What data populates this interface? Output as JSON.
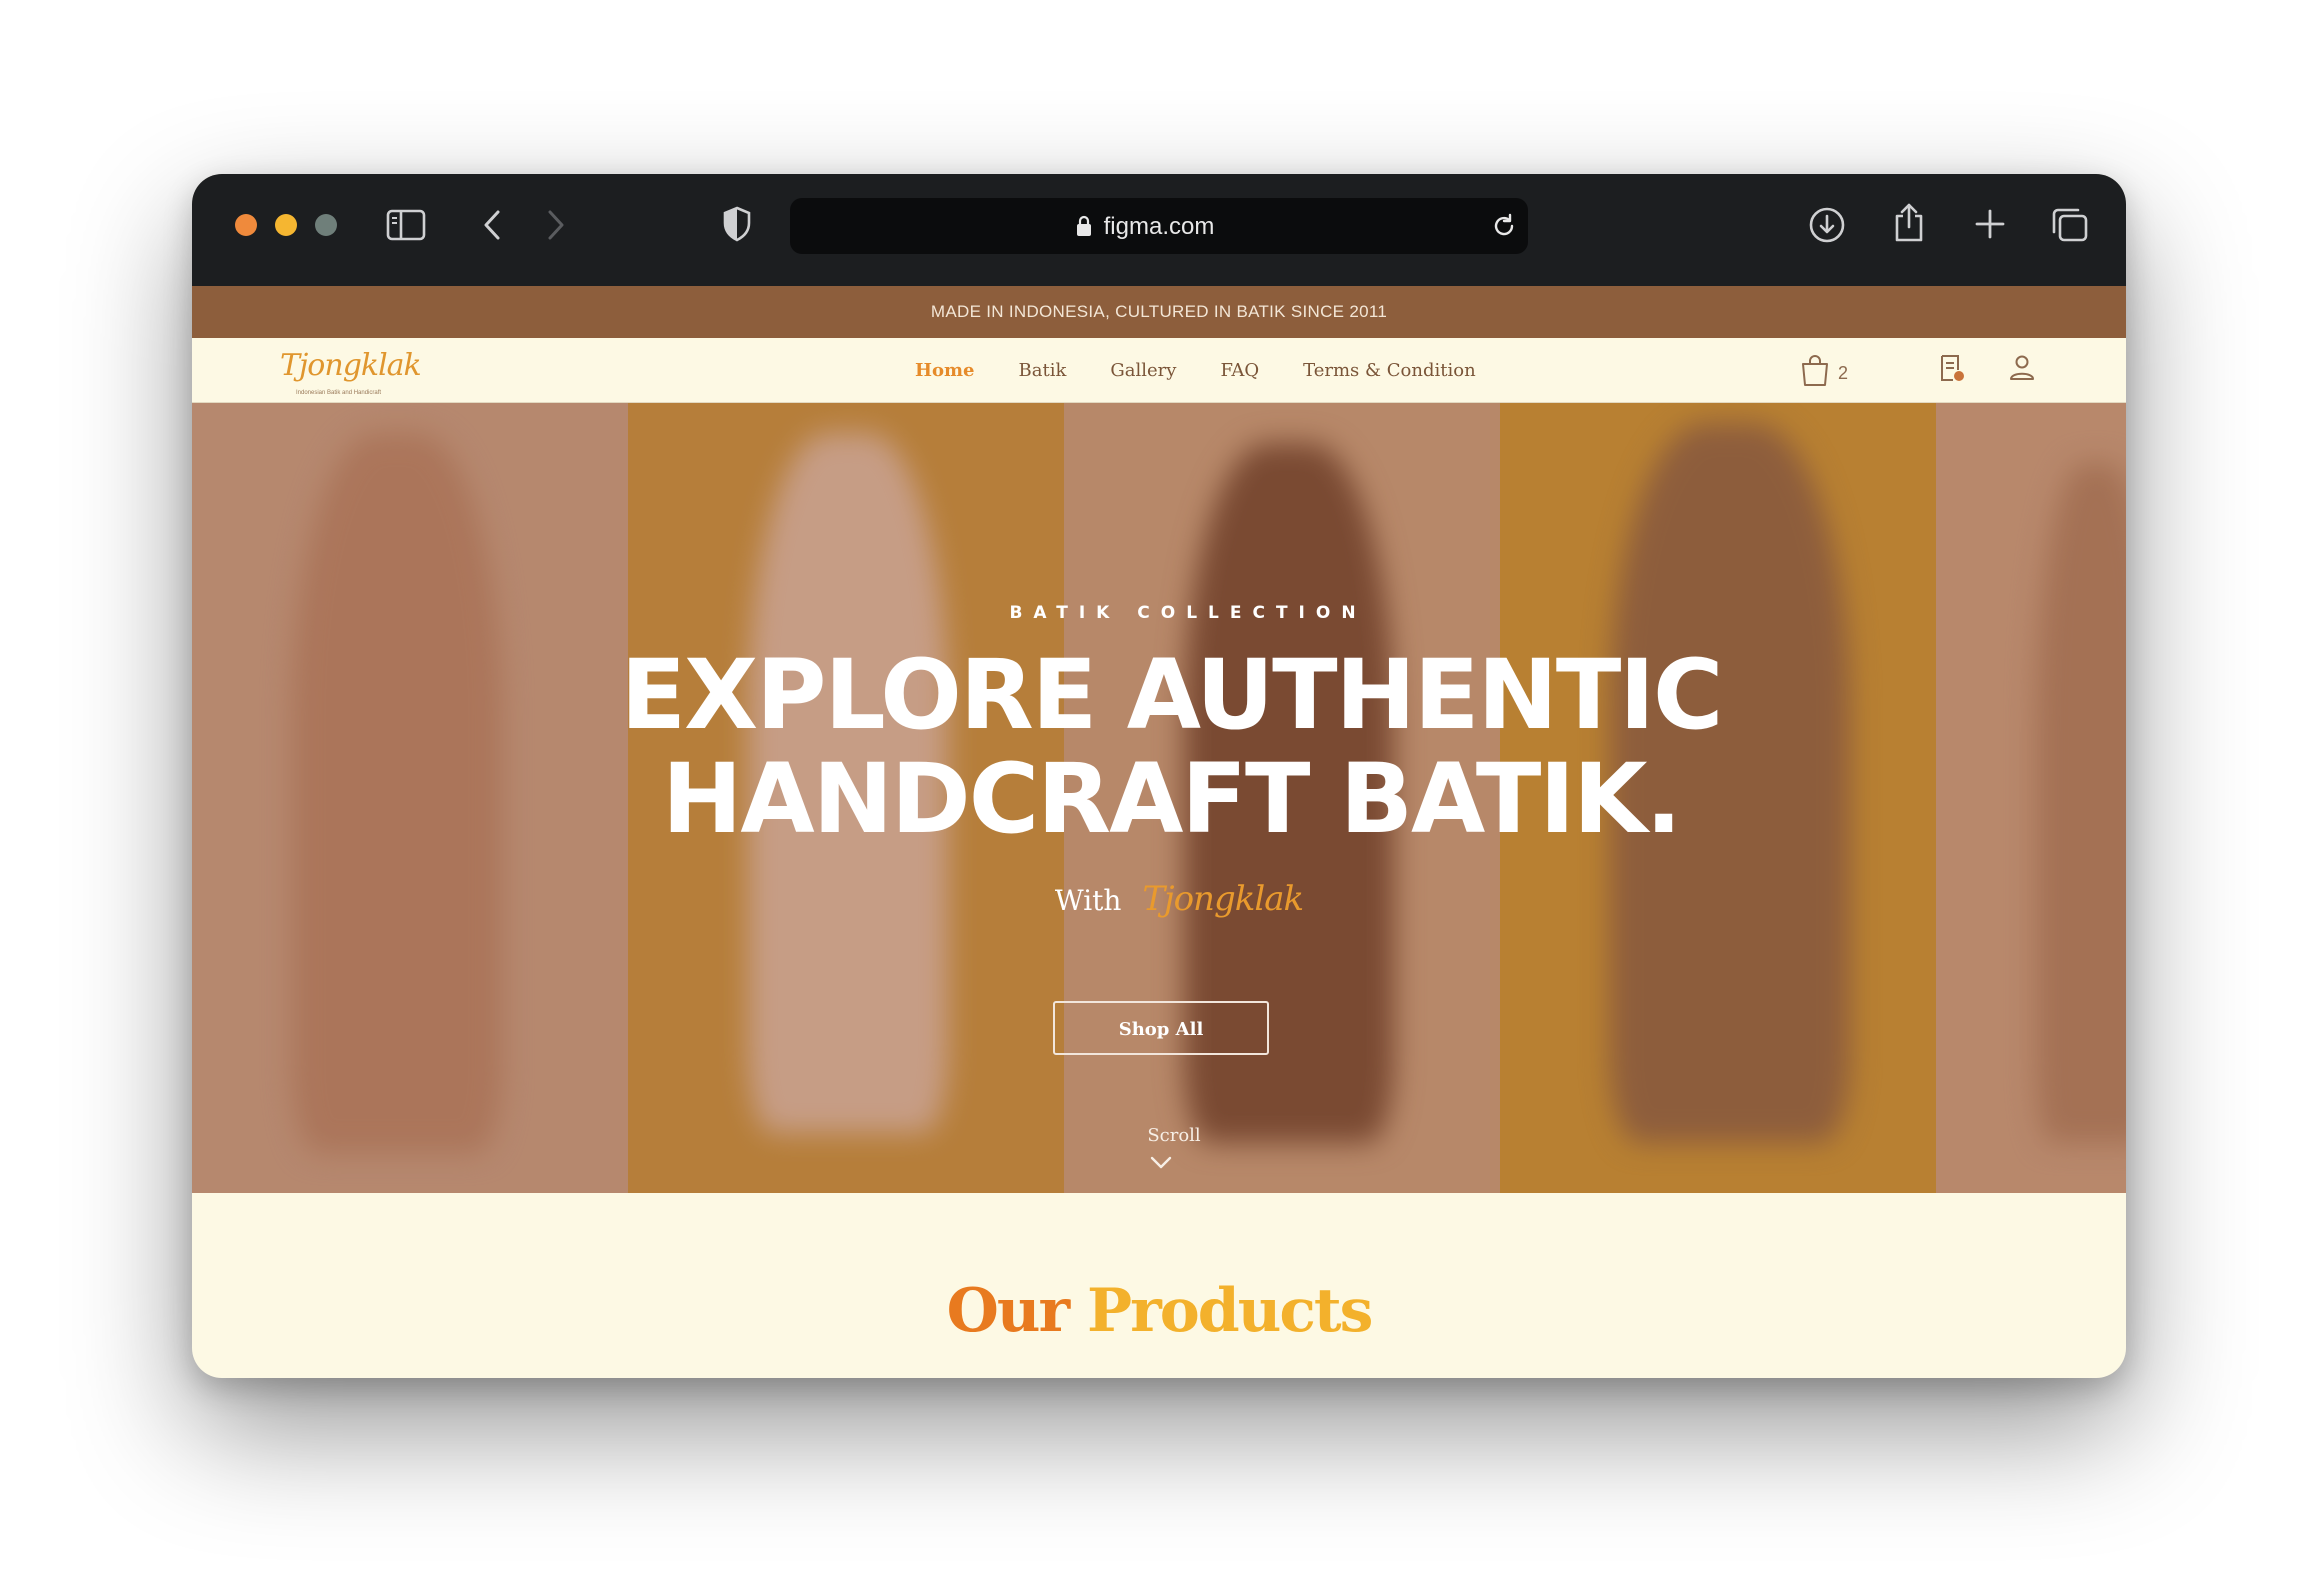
{
  "browser": {
    "url": "figma.com"
  },
  "site": {
    "announcement": "MADE IN INDONESIA, CULTURED IN BATIK SINCE 2011",
    "logo_text": "Tjongklak",
    "logo_tagline": "Indonesian Batik and Handicraft",
    "nav": [
      "Home",
      "Batik",
      "Gallery",
      "FAQ",
      "Terms & Condition"
    ],
    "active_nav": "Home",
    "cart_count": "2"
  },
  "hero": {
    "eyebrow": "BATIK COLLECTION",
    "title_line1": "EXPLORE AUTHENTIC",
    "title_line2": "HANDCRAFT BATIK.",
    "with_label": "With",
    "brand": "Tjongklak",
    "cta": "Shop All",
    "scroll": "Scroll"
  },
  "products": {
    "title_word1": "Our",
    "title_word2": "Products"
  },
  "colors": {
    "announce_bg": "#8d5e3c",
    "nav_bg": "#fdf9e4",
    "accent": "#e68b2a",
    "accent_light": "#f3b12c",
    "chrome_bg": "#1c1e20"
  }
}
